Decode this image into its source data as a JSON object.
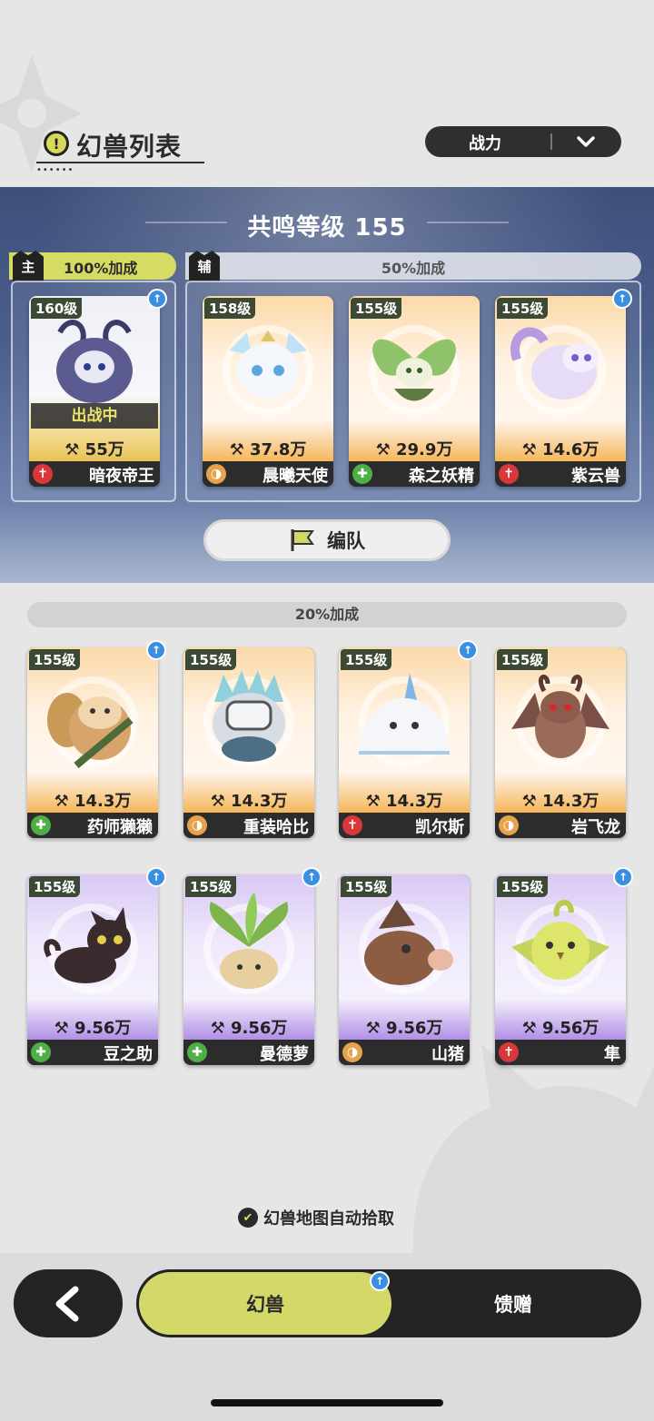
{
  "header": {
    "title": "幻兽列表",
    "title_icon": "alert-icon",
    "sort_label": "战力",
    "sort_icon": "chevron-down-icon"
  },
  "resonance": {
    "label": "共鸣等级 155",
    "main_badge": "主",
    "main_bonus": "100%加成",
    "sub_badge": "辅",
    "sub_bonus": "50%加成",
    "team_button": "编队",
    "team_icon": "flag-icon"
  },
  "main_card": {
    "level": "160级",
    "power": "55万",
    "name": "暗夜帝王",
    "role": "attack",
    "status": "出战中",
    "upgrade": true
  },
  "sub_cards": [
    {
      "level": "158级",
      "power": "37.8万",
      "name": "晨曦天使",
      "role": "defense",
      "upgrade": false
    },
    {
      "level": "155级",
      "power": "29.9万",
      "name": "森之妖精",
      "role": "support",
      "upgrade": false
    },
    {
      "level": "155级",
      "power": "14.6万",
      "name": "紫云兽",
      "role": "attack",
      "upgrade": true
    }
  ],
  "pool_bonus": "20%加成",
  "pool_cards": [
    {
      "level": "155级",
      "power": "14.3万",
      "name": "药师獭獭",
      "role": "support",
      "upgrade": true
    },
    {
      "level": "155级",
      "power": "14.3万",
      "name": "重装哈比",
      "role": "defense",
      "upgrade": false
    },
    {
      "level": "155级",
      "power": "14.3万",
      "name": "凯尔斯",
      "role": "attack",
      "upgrade": true
    },
    {
      "level": "155级",
      "power": "14.3万",
      "name": "岩飞龙",
      "role": "defense",
      "upgrade": false
    },
    {
      "level": "155级",
      "power": "9.56万",
      "name": "豆之助",
      "role": "support",
      "upgrade": true
    },
    {
      "level": "155级",
      "power": "9.56万",
      "name": "曼德萝",
      "role": "support",
      "upgrade": true
    },
    {
      "level": "155级",
      "power": "9.56万",
      "name": "山猪",
      "role": "defense",
      "upgrade": false
    },
    {
      "level": "155级",
      "power": "9.56万",
      "name": "隼",
      "role": "attack",
      "upgrade": true
    }
  ],
  "auto_pickup": "幻兽地图自动拾取",
  "tabs": {
    "active": "幻兽",
    "inactive": "馈赠"
  },
  "colors": {
    "accent": "#d4d868",
    "attack": "#d9373a",
    "defense": "#e6a34b",
    "support": "#4faf47",
    "upgrade": "#3b8fe0"
  }
}
